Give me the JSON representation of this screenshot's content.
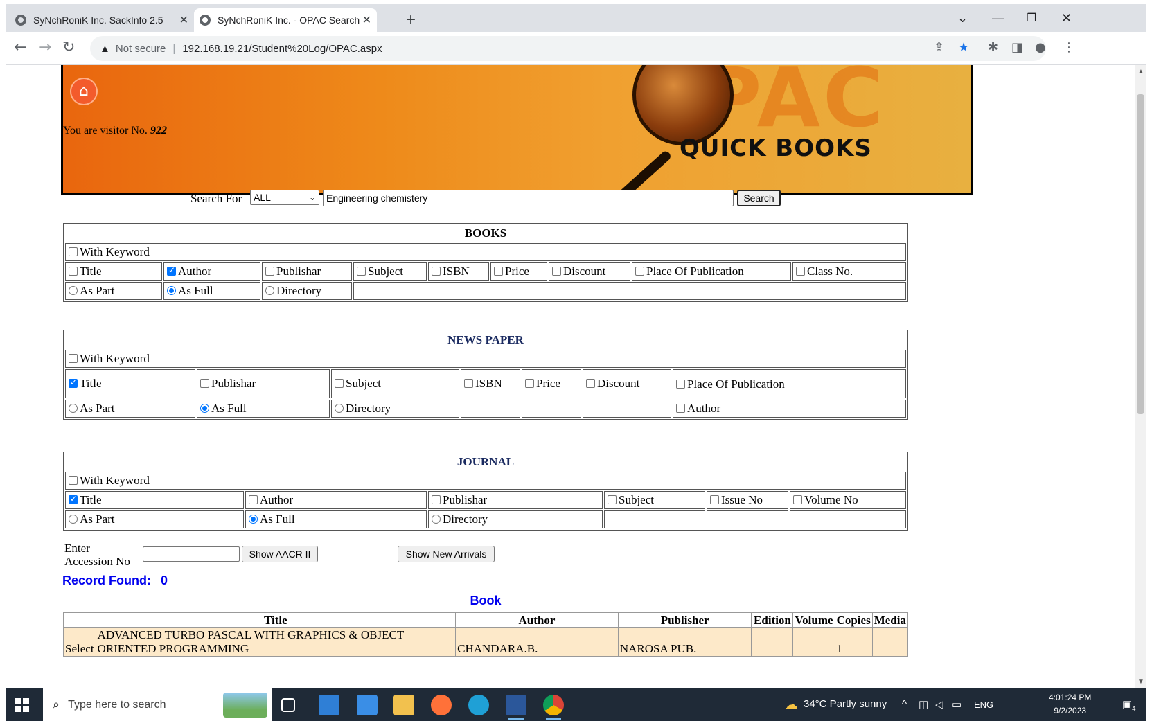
{
  "browser": {
    "tabs": [
      {
        "title": "SyNchRoniK Inc. SackInfo 2.5",
        "active": false
      },
      {
        "title": "SyNchRoniK Inc. - OPAC Search",
        "active": true
      }
    ],
    "address": {
      "warning": "Not secure",
      "url": "192.168.19.21/Student%20Log/OPAC.aspx"
    }
  },
  "banner": {
    "visitor_prefix": "You are visitor No.",
    "visitor_number": "922",
    "logo_text": "PAC",
    "subtitle": "QUICK BOOKS"
  },
  "search": {
    "label": "Search For",
    "scope": "ALL",
    "query": "Engineering chemistery",
    "button": "Search"
  },
  "books": {
    "heading": "BOOKS",
    "keyword": "With Keyword",
    "fields": [
      "Title",
      "Author",
      "Publishar",
      "Subject",
      "ISBN",
      "Price",
      "Discount",
      "Place Of Publication",
      "Class No."
    ],
    "match": [
      "As Part",
      "As Full",
      "Directory"
    ]
  },
  "newspaper": {
    "heading": "NEWS PAPER",
    "keyword": "With Keyword",
    "fields": [
      "Title",
      "Publishar",
      "Subject",
      "ISBN",
      "Price",
      "Discount",
      "Place Of Publication"
    ],
    "match": [
      "As Part",
      "As Full",
      "Directory"
    ],
    "extra": "Author"
  },
  "journal": {
    "heading": "JOURNAL",
    "keyword": "With Keyword",
    "fields": [
      "Title",
      "Author",
      "Publishar",
      "Subject",
      "Issue No",
      "Volume No"
    ],
    "match": [
      "As Part",
      "As Full",
      "Directory"
    ]
  },
  "accession": {
    "label_line1": "Enter",
    "label_line2": "Accession No",
    "value": "",
    "aacr_button": "Show AACR II",
    "arrivals_button": "Show New Arrivals"
  },
  "result": {
    "record_label": "Record Found:",
    "record_count": "0",
    "section": "Book",
    "columns": [
      "Title",
      "Author",
      "Publisher",
      "Edition",
      "Volume",
      "Copies",
      "Media"
    ],
    "rows": [
      {
        "select": "Select",
        "title": "ADVANCED TURBO PASCAL WITH GRAPHICS & OBJECT ORIENTED PROGRAMMING",
        "author": "CHANDARA.B.",
        "publisher": "NAROSA PUB.",
        "edition": "",
        "volume": "",
        "copies": "1",
        "media": ""
      }
    ]
  },
  "taskbar": {
    "search_placeholder": "Type here to search",
    "weather": "34°C  Partly sunny",
    "lang": "ENG",
    "time": "4:01:24 PM",
    "date": "9/2/2023",
    "notifications": "4"
  },
  "colors": {
    "accent": "#0000ee",
    "banner_orange": "#e9660e",
    "checkbox_blue": "#0075ff",
    "result_row": "#fde9c9"
  }
}
